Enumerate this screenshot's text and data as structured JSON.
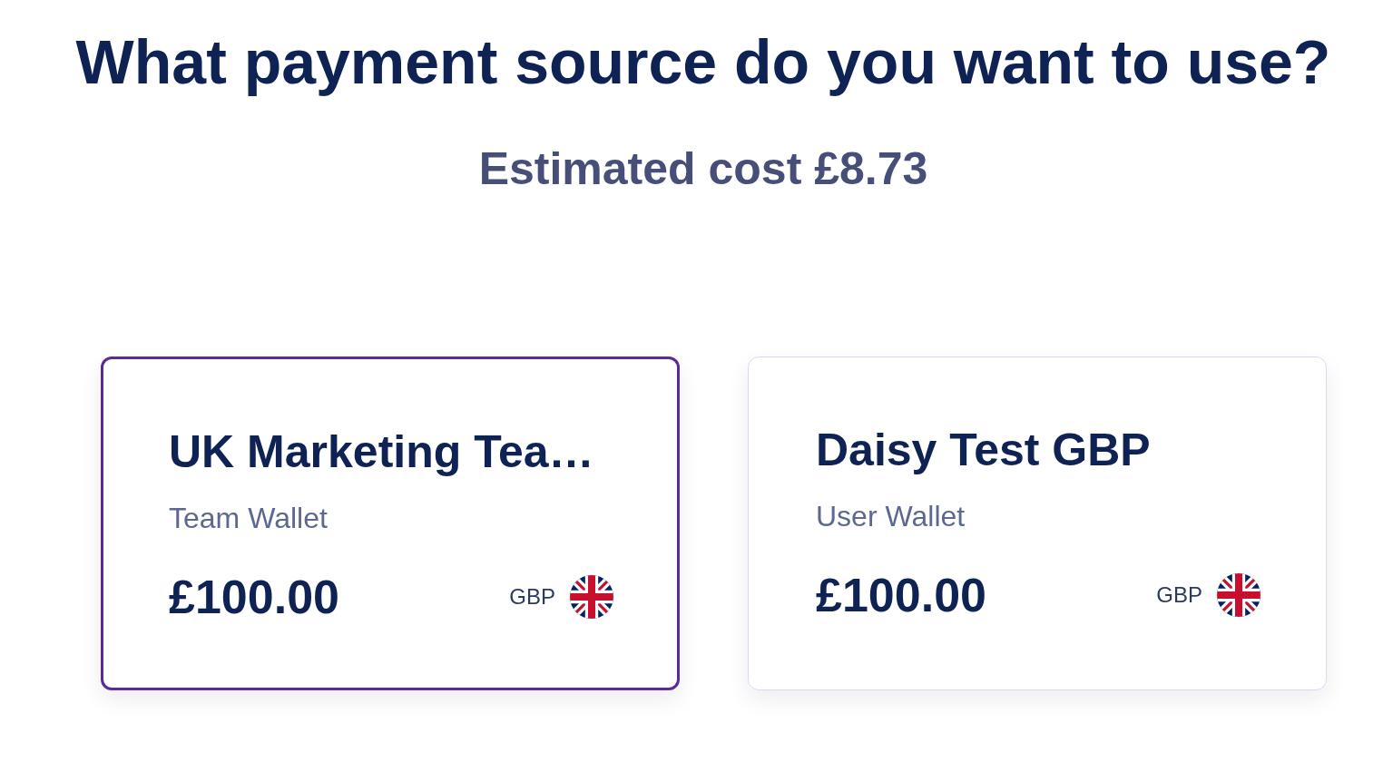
{
  "heading": "What payment source do you want to use?",
  "estimated_cost": "Estimated cost £8.73",
  "wallets": [
    {
      "name": "UK Marketing Tea…",
      "type": "Team Wallet",
      "balance": "£100.00",
      "currency": "GBP",
      "selected": true
    },
    {
      "name": "Daisy Test GBP",
      "type": "User Wallet",
      "balance": "£100.00",
      "currency": "GBP",
      "selected": false
    }
  ]
}
